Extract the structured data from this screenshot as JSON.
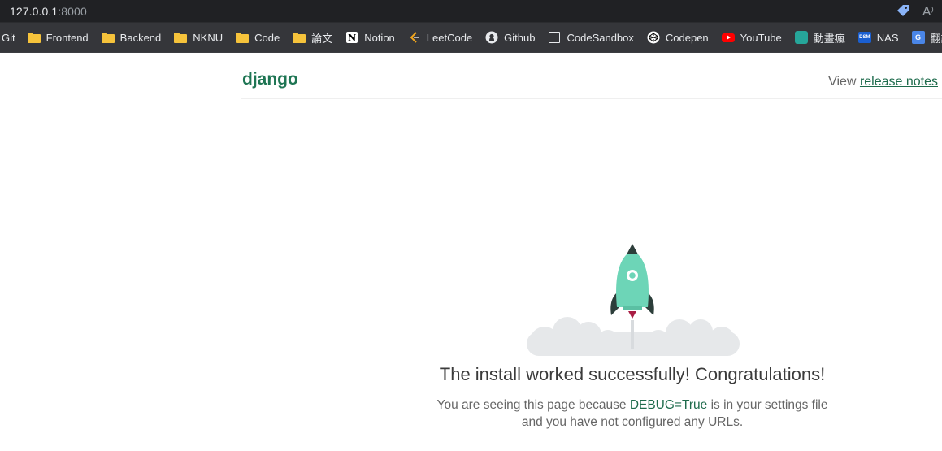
{
  "browser": {
    "url_host": "127.0.0.1",
    "url_port": ":8000",
    "bookmarks": [
      {
        "label": "Git",
        "icon": "none"
      },
      {
        "label": "Frontend",
        "icon": "folder-icon"
      },
      {
        "label": "Backend",
        "icon": "folder-icon"
      },
      {
        "label": "NKNU",
        "icon": "folder-icon"
      },
      {
        "label": "Code",
        "icon": "folder-icon"
      },
      {
        "label": "論文",
        "icon": "folder-icon"
      },
      {
        "label": "Notion",
        "icon": "notion-icon"
      },
      {
        "label": "LeetCode",
        "icon": "leetcode-icon"
      },
      {
        "label": "Github",
        "icon": "github-icon"
      },
      {
        "label": "CodeSandbox",
        "icon": "codesandbox-icon"
      },
      {
        "label": "Codepen",
        "icon": "codepen-icon"
      },
      {
        "label": "YouTube",
        "icon": "youtube-icon"
      },
      {
        "label": "動畫瘋",
        "icon": "animation-icon"
      },
      {
        "label": "NAS",
        "icon": "dsm-icon"
      },
      {
        "label": "翻譯",
        "icon": "google-translate-icon"
      }
    ],
    "dsm_text": "DSM",
    "translate_text": "G"
  },
  "django": {
    "logo": "django",
    "release_prefix": "View ",
    "release_link": "release notes",
    "headline": "The install worked successfully! Congratulations!",
    "sub_before": "You are seeing this page because ",
    "sub_link": "DEBUG=True",
    "sub_after": " is in your settings file and you have not configured any URLs."
  },
  "colors": {
    "brand_green": "#1e7553",
    "rocket_body": "#6dd5b7",
    "rocket_dark": "#2c3e3a",
    "cloud": "#e6e8ea",
    "flame": "#a91d44"
  }
}
